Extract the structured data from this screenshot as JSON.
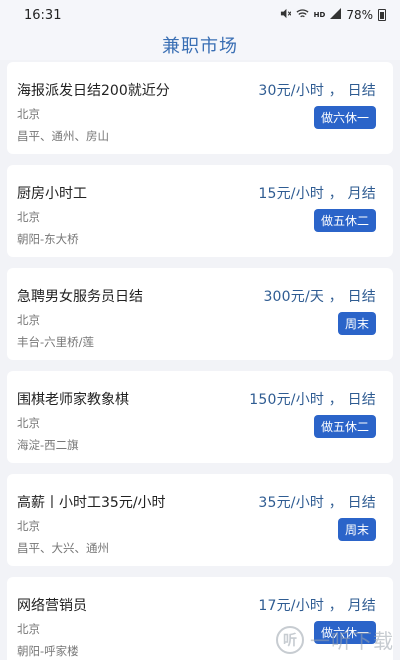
{
  "status_bar": {
    "time": "16:31",
    "battery": "78%",
    "icons": [
      "mute-icon",
      "wifi-icon",
      "hd-signal-icon",
      "signal-icon",
      "battery-icon"
    ],
    "hd_label": "HD"
  },
  "header": {
    "title": "兼职市场"
  },
  "jobs": [
    {
      "title": "海报派发日结200就近分",
      "salary": "30元/小时 ， 日结",
      "city": "北京",
      "district": "昌平、通州、房山",
      "schedule": "做六休一"
    },
    {
      "title": "厨房小时工",
      "salary": "15元/小时 ， 月结",
      "city": "北京",
      "district": "朝阳-东大桥",
      "schedule": "做五休二"
    },
    {
      "title": "急聘男女服务员日结",
      "salary": "300元/天 ， 日结",
      "city": "北京",
      "district": "丰台-六里桥/莲",
      "schedule": "周末"
    },
    {
      "title": "围棋老师家教象棋",
      "salary": "150元/小时 ， 日结",
      "city": "北京",
      "district": "海淀-西二旗",
      "schedule": "做五休二"
    },
    {
      "title": "高薪丨小时工35元/小时",
      "salary": "35元/小时 ， 日结",
      "city": "北京",
      "district": "昌平、大兴、通州",
      "schedule": "周末"
    },
    {
      "title": "网络营销员",
      "salary": "17元/小时 ， 月结",
      "city": "北京",
      "district": "朝阳-呼家楼",
      "schedule": "做六休一"
    }
  ],
  "watermark": {
    "text": "一听下载",
    "logo_glyph": "听"
  },
  "colors": {
    "accent": "#2b64c9",
    "title_blue": "#3a6fb4",
    "salary_blue": "#2f5c92",
    "background": "#f2f3f7"
  }
}
